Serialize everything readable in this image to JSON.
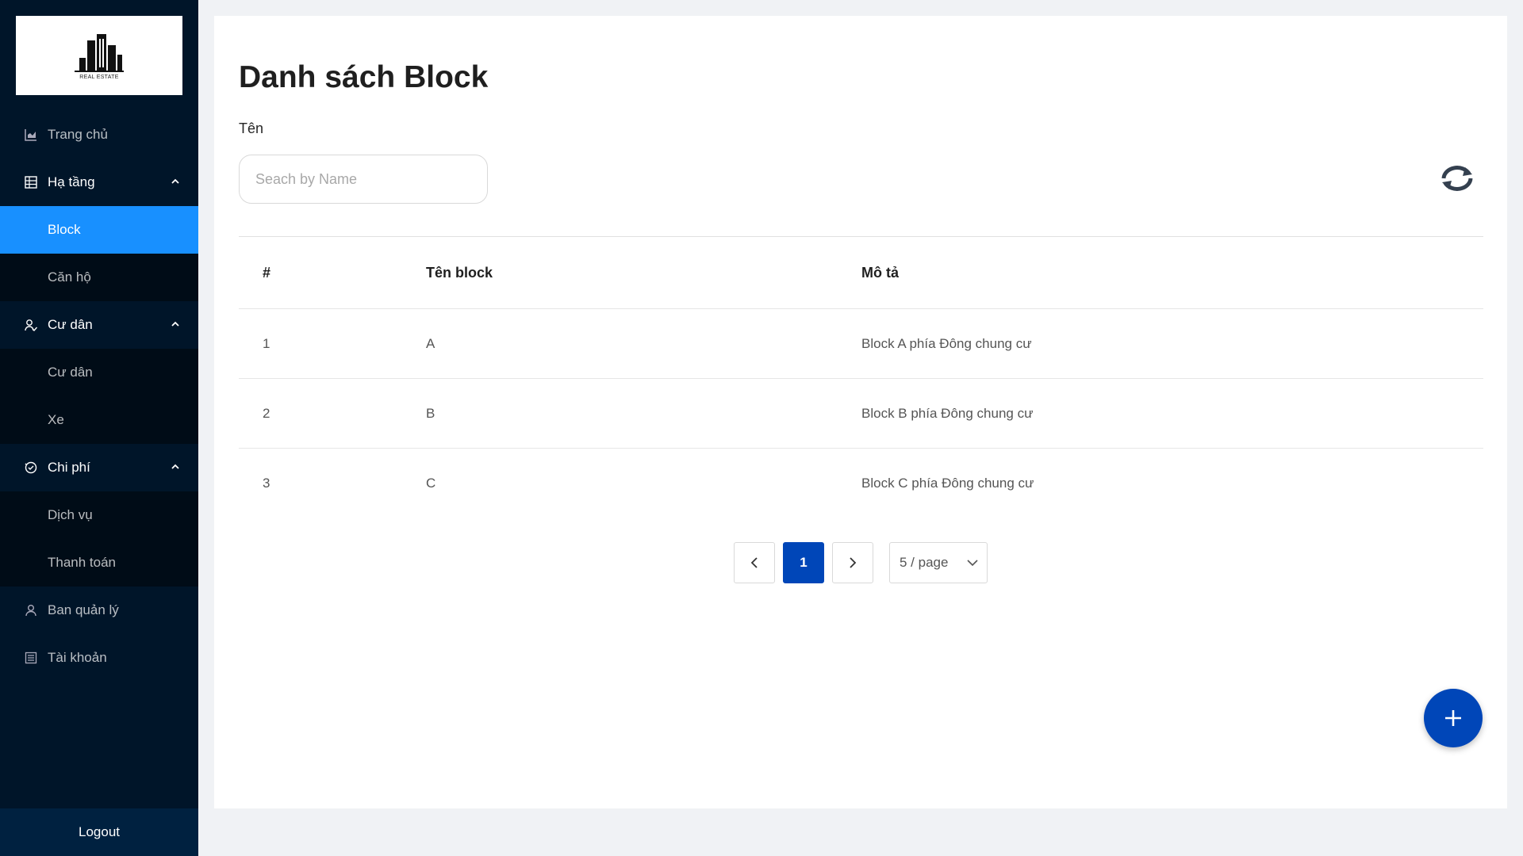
{
  "sidebar": {
    "logo_text": "REAL ESTATE",
    "menu": {
      "home": "Trang chủ",
      "infrastructure": "Hạ tầng",
      "block": "Block",
      "apartment": "Căn hộ",
      "residents_group": "Cư dân",
      "residents": "Cư dân",
      "vehicles": "Xe",
      "costs": "Chi phí",
      "services": "Dịch vụ",
      "payments": "Thanh toán",
      "management": "Ban quản lý",
      "account": "Tài khoản"
    },
    "logout": "Logout"
  },
  "main": {
    "title": "Danh sách Block",
    "filter_label": "Tên",
    "search_placeholder": "Seach by Name",
    "search_value": "",
    "table": {
      "headers": [
        "#",
        "Tên block",
        "Mô tả"
      ],
      "rows": [
        [
          "1",
          "A",
          "Block A phía Đông chung cư"
        ],
        [
          "2",
          "B",
          "Block B phía Đông chung cư"
        ],
        [
          "3",
          "C",
          "Block C phía Đông chung cư"
        ]
      ]
    },
    "pagination": {
      "current_page": "1",
      "page_size": "5 / page"
    }
  },
  "colors": {
    "sidebar_bg": "#001529",
    "selected": "#1890ff",
    "primary": "#0046b8"
  },
  "icons": [
    "chart-icon",
    "table-icon",
    "users-icon",
    "clock-money-icon",
    "user-icon",
    "list-icon",
    "refresh-icon",
    "plus-icon",
    "chevron-up-icon",
    "chevron-left-icon",
    "chevron-right-icon",
    "chevron-down-icon"
  ]
}
